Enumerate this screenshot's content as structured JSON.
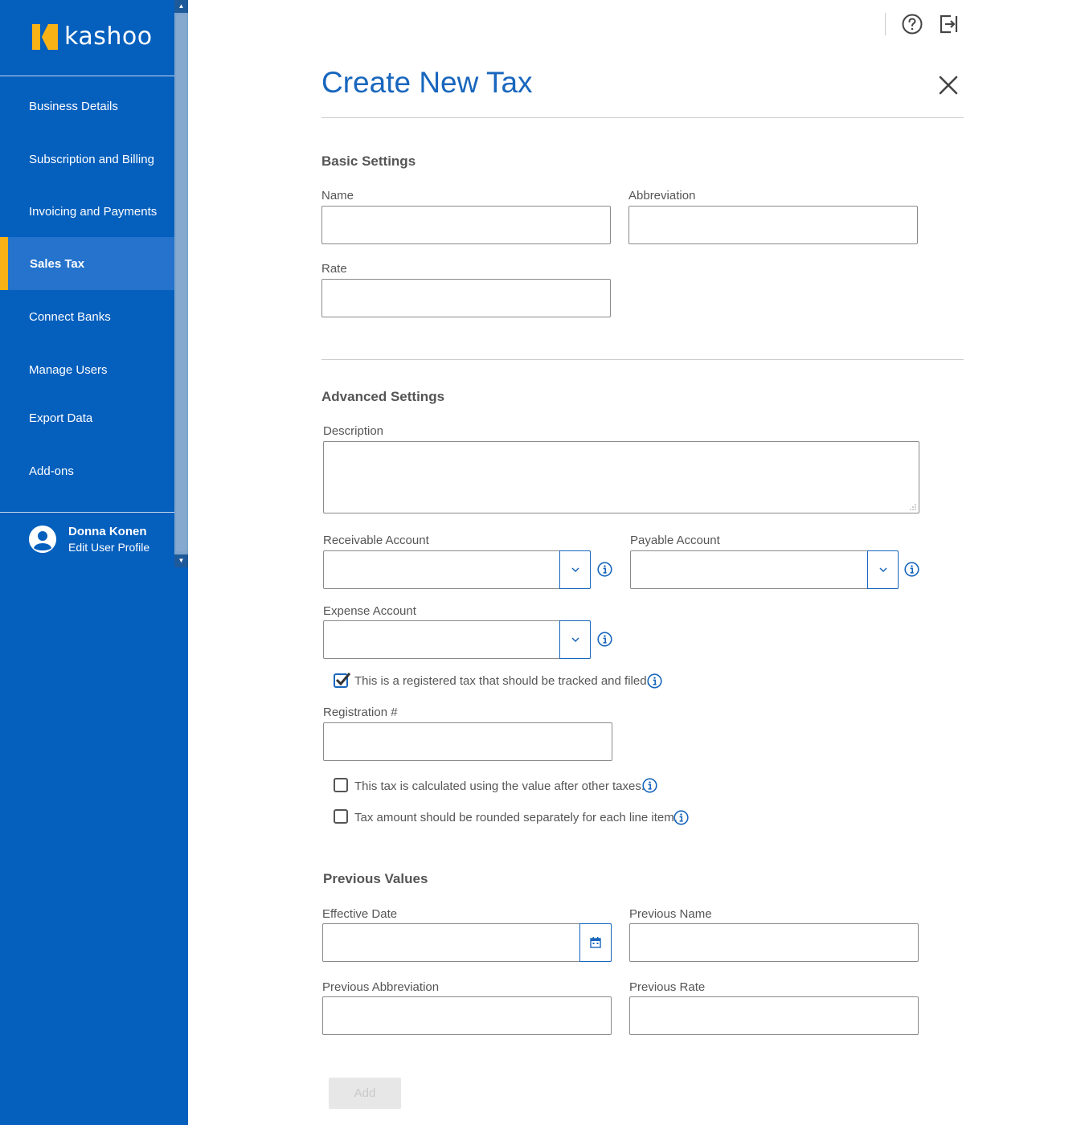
{
  "app": {
    "logo_text": "kashoo",
    "brand_color": "#045fbd",
    "accent_color": "#f9b215"
  },
  "sidebar": {
    "items": [
      {
        "label": "Business Details",
        "active": false
      },
      {
        "label": "Subscription and Billing",
        "active": false
      },
      {
        "label": "Invoicing and Payments",
        "active": false
      },
      {
        "label": "Sales Tax",
        "active": true
      },
      {
        "label": "Connect Banks",
        "active": false
      },
      {
        "label": "Manage Users",
        "active": false
      },
      {
        "label": "Export Data",
        "active": false
      },
      {
        "label": "Add-ons",
        "active": false
      }
    ],
    "user": {
      "name": "Donna Konen",
      "edit_label": "Edit User Profile"
    }
  },
  "header": {
    "icons": [
      "help-icon",
      "logout-icon"
    ]
  },
  "form": {
    "title": "Create New Tax",
    "basic": {
      "heading": "Basic Settings",
      "name_label": "Name",
      "name_value": "",
      "abbreviation_label": "Abbreviation",
      "abbreviation_value": "",
      "rate_label": "Rate",
      "rate_value": ""
    },
    "advanced": {
      "heading": "Advanced Settings",
      "description_label": "Description",
      "description_value": "",
      "receivable_label": "Receivable Account",
      "receivable_value": "",
      "payable_label": "Payable Account",
      "payable_value": "",
      "expense_label": "Expense Account",
      "expense_value": "",
      "registered_label": "This is a registered tax that should be tracked and filed.",
      "registered_checked": true,
      "registration_label": "Registration #",
      "registration_value": "",
      "after_taxes_label": "This tax is calculated using the value after other taxes.",
      "after_taxes_checked": false,
      "rounded_label": "Tax amount should be rounded separately for each line item.",
      "rounded_checked": false
    },
    "previous": {
      "heading": "Previous Values",
      "effective_date_label": "Effective Date",
      "effective_date_value": "",
      "previous_name_label": "Previous Name",
      "previous_name_value": "",
      "previous_abbreviation_label": "Previous Abbreviation",
      "previous_abbreviation_value": "",
      "previous_rate_label": "Previous Rate",
      "previous_rate_value": ""
    },
    "add_label": "Add"
  }
}
